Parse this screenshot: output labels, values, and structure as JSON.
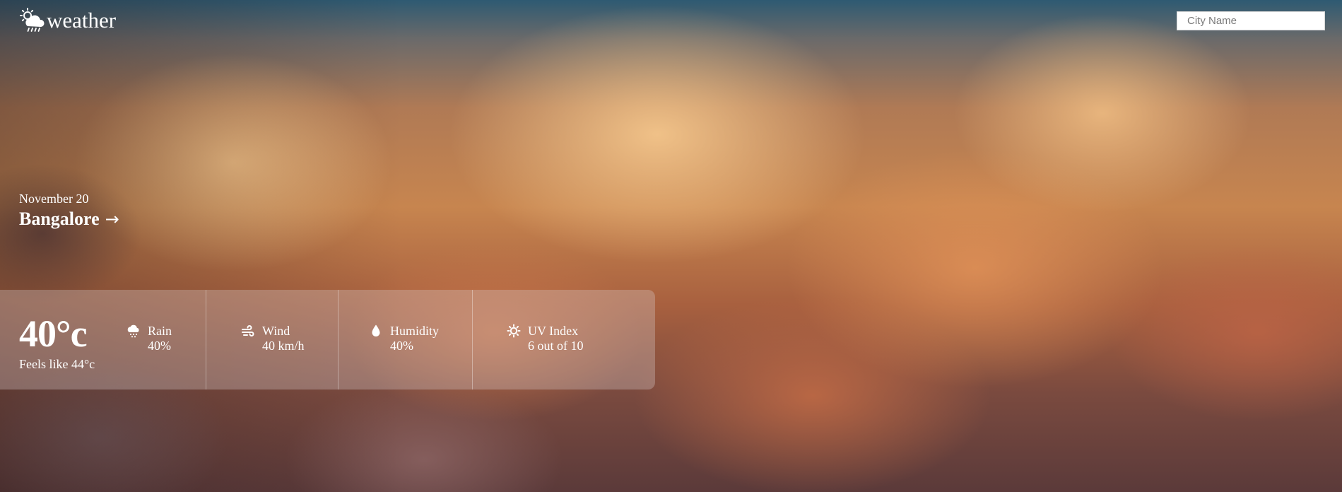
{
  "header": {
    "app_title": "weather",
    "logo_icon": "sun-behind-rain-cloud-icon"
  },
  "search": {
    "placeholder": "City Name",
    "value": ""
  },
  "location": {
    "date": "November 20",
    "city": "Bangalore",
    "arrow": "→"
  },
  "current": {
    "temperature": "40°c",
    "feels_like": "Feels like 44°c"
  },
  "metrics": [
    {
      "label": "Rain",
      "value": "40%",
      "icon": "rain-cloud-icon"
    },
    {
      "label": "Wind",
      "value": "40 km/h",
      "icon": "wind-icon"
    },
    {
      "label": "Humidity",
      "value": "40%",
      "icon": "droplet-icon"
    },
    {
      "label": "UV Index",
      "value": "6 out of 10",
      "icon": "sun-icon"
    }
  ],
  "colors": {
    "text": "#ffffff",
    "panel": "rgba(215,200,200,0.34)",
    "sky_top": "#2e5a72",
    "cloud_warm": "#c7854f"
  }
}
